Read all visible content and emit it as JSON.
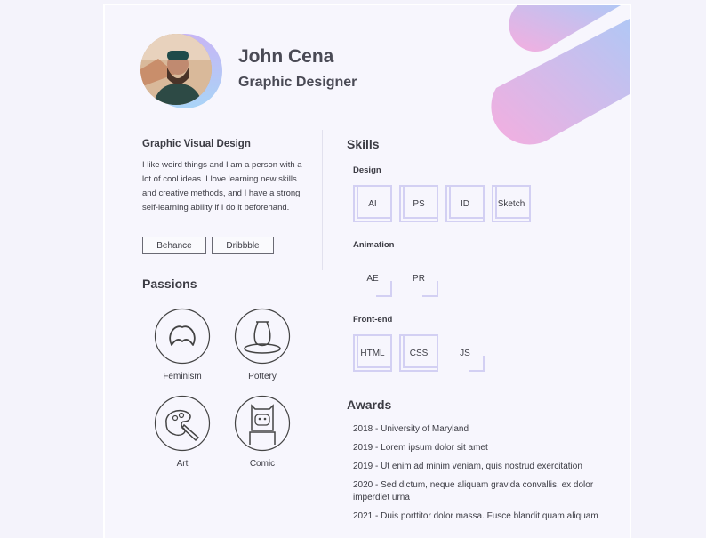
{
  "profile": {
    "name": "John Cena",
    "role": "Graphic Designer"
  },
  "intro": {
    "title": "Graphic Visual Design",
    "text": "I like weird things and I am a person with a lot of cool ideas. I love learning new skills and creative methods, and I have a strong self-learning ability if I do it beforehand.",
    "links": [
      "Behance",
      "Dribbble"
    ]
  },
  "passions": {
    "title": "Passions",
    "items": [
      {
        "label": "Feminism",
        "icon": "feminism-icon"
      },
      {
        "label": "Pottery",
        "icon": "pottery-icon"
      },
      {
        "label": "Art",
        "icon": "palette-icon"
      },
      {
        "label": "Comic",
        "icon": "comic-character-icon"
      }
    ]
  },
  "skills": {
    "title": "Skills",
    "groups": [
      {
        "label": "Design",
        "items": [
          "AI",
          "PS",
          "ID",
          "Sketch"
        ]
      },
      {
        "label": "Animation",
        "items": [
          "AE",
          "PR"
        ]
      },
      {
        "label": "Front-end",
        "items": [
          "HTML",
          "CSS",
          "JS"
        ]
      }
    ]
  },
  "awards": {
    "title": "Awards",
    "items": [
      "2018 - University of Maryland",
      "2019 - Lorem ipsum dolor sit amet",
      "2019 - Ut enim ad minim veniam, quis nostrud exercitation",
      "2020 - Sed dictum, neque aliquam gravida convallis, ex dolor imperdiet urna",
      "2021 - Duis porttitor dolor massa. Fusce blandit quam aliquam"
    ]
  },
  "colors": {
    "gradient_pink": "#f4a6dc",
    "gradient_blue": "#a9c2f4",
    "box_stroke": "#d3d0f3"
  }
}
